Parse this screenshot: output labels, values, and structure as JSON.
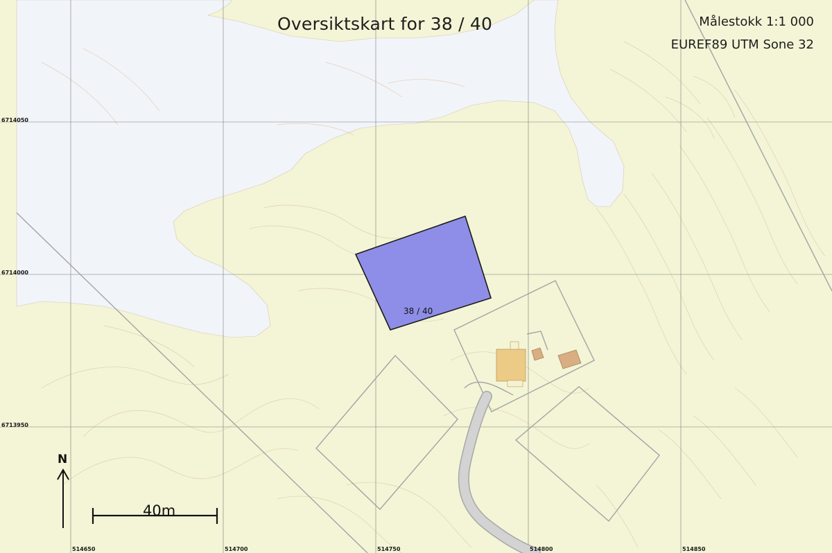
{
  "title": "Oversiktskart for 38 / 40",
  "scale": "Målestokk 1:1 000",
  "crs": "EUREF89 UTM Sone 32",
  "parcel_label": "38 / 40",
  "north_label": "N",
  "scalebar_label": "40m",
  "grid": {
    "x_labels": [
      "514650",
      "514700",
      "514750",
      "514800",
      "514850"
    ],
    "y_labels": [
      "6714050",
      "6714000",
      "6713950"
    ]
  },
  "colors": {
    "land": "#f3f5d6",
    "water": "#f1f5f9",
    "parcel_fill": "#8e8ee8",
    "building": "#eccb87",
    "contour": "#e2bfa3",
    "grid": "#7b7b7b",
    "road": "#cfd0cf"
  }
}
